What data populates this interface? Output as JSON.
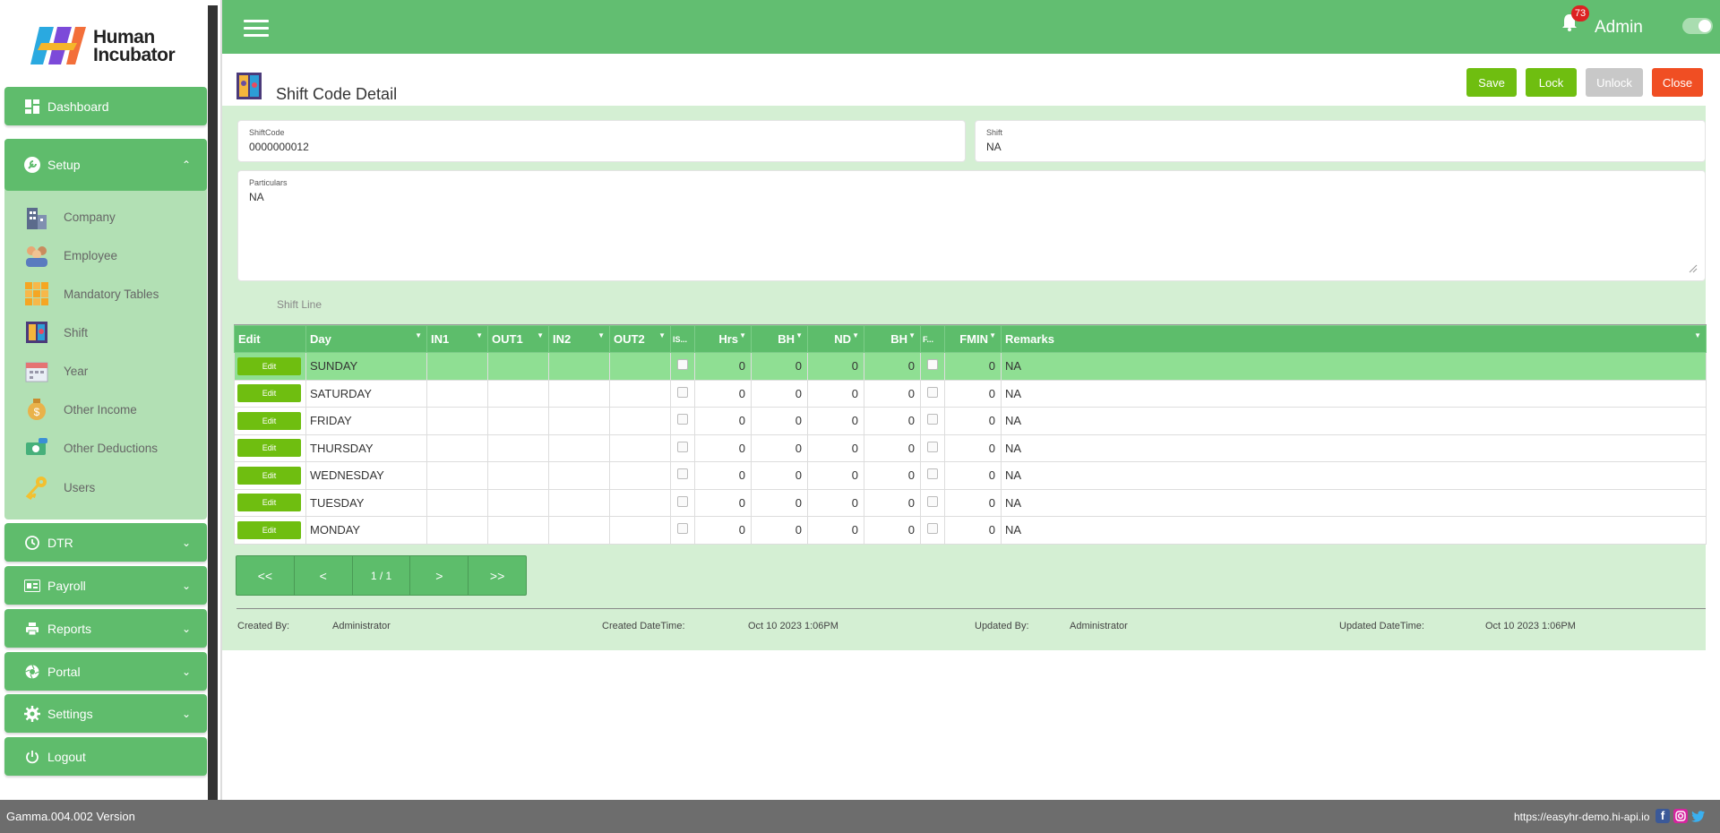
{
  "brand": {
    "line1": "Human",
    "line2": "Incubator"
  },
  "sidebar": {
    "dashboard": "Dashboard",
    "setup": "Setup",
    "setup_items": [
      {
        "label": "Company",
        "icon": "company-icon"
      },
      {
        "label": "Employee",
        "icon": "employee-icon"
      },
      {
        "label": "Mandatory Tables",
        "icon": "mandatory-tables-icon"
      },
      {
        "label": "Shift",
        "icon": "shift-icon"
      },
      {
        "label": "Year",
        "icon": "year-icon"
      },
      {
        "label": "Other Income",
        "icon": "other-income-icon"
      },
      {
        "label": "Other Deductions",
        "icon": "other-deductions-icon"
      },
      {
        "label": "Users",
        "icon": "users-key-icon"
      }
    ],
    "dtr": "DTR",
    "payroll": "Payroll",
    "reports": "Reports",
    "portal": "Portal",
    "settings": "Settings",
    "logout": "Logout"
  },
  "topbar": {
    "notifications": "73",
    "user": "Admin"
  },
  "page": {
    "title": "Shift Code Detail"
  },
  "actions": {
    "save": "Save",
    "lock": "Lock",
    "unlock": "Unlock",
    "close": "Close"
  },
  "form": {
    "shiftcode_label": "ShiftCode",
    "shiftcode_value": "0000000012",
    "shift_label": "Shift",
    "shift_value": "NA",
    "particulars_label": "Particulars",
    "particulars_value": "NA"
  },
  "shift_line_label": "Shift Line",
  "grid": {
    "columns": [
      "Edit",
      "Day",
      "IN1",
      "OUT1",
      "IN2",
      "OUT2",
      "IS...",
      "Hrs",
      "BH",
      "ND",
      "BH",
      "F...",
      "FMIN",
      "Remarks"
    ],
    "edit_label": "Edit",
    "rows": [
      {
        "day": "SUNDAY",
        "hrs": "0",
        "bh": "0",
        "nd": "0",
        "bh2": "0",
        "fmin": "0",
        "remarks": "NA"
      },
      {
        "day": "SATURDAY",
        "hrs": "0",
        "bh": "0",
        "nd": "0",
        "bh2": "0",
        "fmin": "0",
        "remarks": "NA"
      },
      {
        "day": "FRIDAY",
        "hrs": "0",
        "bh": "0",
        "nd": "0",
        "bh2": "0",
        "fmin": "0",
        "remarks": "NA"
      },
      {
        "day": "THURSDAY",
        "hrs": "0",
        "bh": "0",
        "nd": "0",
        "bh2": "0",
        "fmin": "0",
        "remarks": "NA"
      },
      {
        "day": "WEDNESDAY",
        "hrs": "0",
        "bh": "0",
        "nd": "0",
        "bh2": "0",
        "fmin": "0",
        "remarks": "NA"
      },
      {
        "day": "TUESDAY",
        "hrs": "0",
        "bh": "0",
        "nd": "0",
        "bh2": "0",
        "fmin": "0",
        "remarks": "NA"
      },
      {
        "day": "MONDAY",
        "hrs": "0",
        "bh": "0",
        "nd": "0",
        "bh2": "0",
        "fmin": "0",
        "remarks": "NA"
      }
    ]
  },
  "pager": {
    "first": "<<",
    "prev": "<",
    "page": "1 / 1",
    "next": ">",
    "last": ">>"
  },
  "footer": {
    "created_by_label": "Created By:",
    "created_by": "Administrator",
    "created_dt_label": "Created DateTime:",
    "created_dt": "Oct 10 2023 1:06PM",
    "updated_by_label": "Updated By:",
    "updated_by": "Administrator",
    "updated_dt_label": "Updated DateTime:",
    "updated_dt": "Oct 10 2023 1:06PM"
  },
  "bottom": {
    "version": "Gamma.004.002 Version",
    "url": "https://easyhr-demo.hi-api.io"
  },
  "colors": {
    "primary": "#62be71",
    "panel": "#d4efd3",
    "save": "#6fbe10",
    "lock": "#6fbe10",
    "unlock": "#c8c8c8",
    "close": "#f04e23"
  }
}
